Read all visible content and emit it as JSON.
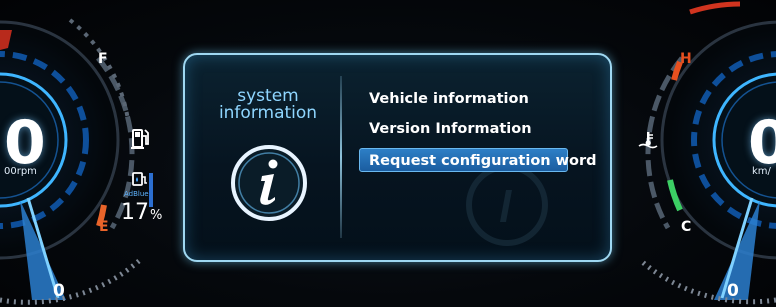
{
  "left_gauge": {
    "rpm_value": "0",
    "rpm_unit": "00rpm",
    "fuel_full_mark": "F",
    "fuel_empty_mark": "E",
    "adblue_label": "AdBlue",
    "adblue_value": "17",
    "adblue_unit": "%",
    "bottom_value": "0"
  },
  "right_gauge": {
    "speed_value": "0",
    "speed_unit": "km/",
    "temp_hot_mark": "H",
    "temp_cold_mark": "C",
    "bottom_value": "0"
  },
  "panel": {
    "title_line1": "system",
    "title_line2": "information",
    "icon": "info-icon",
    "menu": [
      {
        "label": "Vehicle information",
        "selected": false
      },
      {
        "label": "Version Information",
        "selected": false
      },
      {
        "label": "Request configuration word",
        "selected": true
      }
    ]
  },
  "colors": {
    "accent": "#1b5da0",
    "title": "#8fd6ff",
    "warning_red": "#d0341f",
    "fuel_low_orange": "#e9642a",
    "temp_hot_orange": "#e8501f",
    "temp_cold_green": "#3ccf64"
  }
}
